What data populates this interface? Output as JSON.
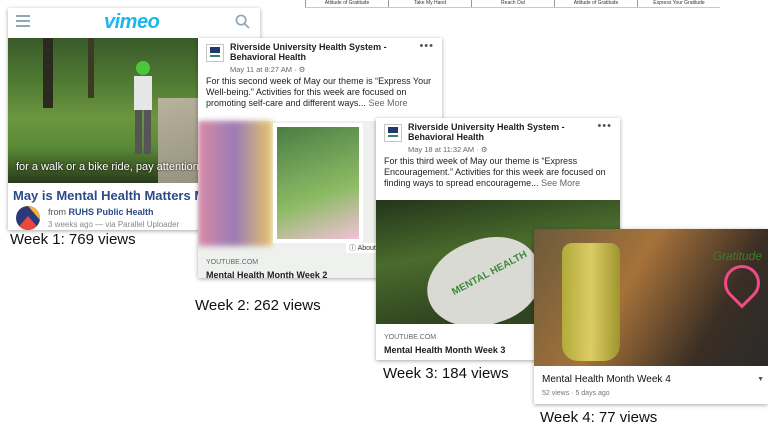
{
  "top_strip": [
    "Attitude of Gratitude",
    "Take My Hand",
    "Reach Out",
    "Attitude of Gratitude",
    "Express Your Gratitude"
  ],
  "vimeo": {
    "logo": "vimeo",
    "caption": "for a walk or a bike ride, pay attention to see how",
    "title": "May is Mental Health Matters Mo",
    "from_prefix": "from",
    "channel": "RUHS Public Health",
    "meta": "3 weeks ago — via Parallel Uploader"
  },
  "week1": "Week 1: 769 views",
  "post2": {
    "org": "Riverside University Health System - Behavioral Health",
    "date": "May 11 at 8:27 AM · ⚙",
    "more": "•••",
    "text": "For this second week of May our theme is “Express Your Well-being.” Activities for this week are focused on promoting self-care and different ways...",
    "see_more": "See More",
    "about": "About",
    "link_domain": "YOUTUBE.COM",
    "link_title": "Mental Health Month Week 2"
  },
  "week2": "Week 2: 262 views",
  "post3": {
    "org": "Riverside University Health System - Behavioral Health",
    "date": "May 18 at 11:32 AM · ⚙",
    "more": "•••",
    "text": "For this third week of May our theme is “Express Encouragement.” Activities for this week are focused on finding ways to spread encourageme...",
    "see_more": "See More",
    "rock_text": "MENTAL HEALTH",
    "link_domain": "YOUTUBE.COM",
    "link_title": "Mental Health Month Week 3"
  },
  "week3": "Week 3: 184 views",
  "youtube": {
    "overlay": "Gratitude",
    "title": "Mental Health Month Week 4",
    "meta": "52 views · 5 days ago"
  },
  "week4": "Week 4: 77 views",
  "colors": {
    "vimeo_blue": "#1ab7ea",
    "link_blue": "#2b4a86",
    "fb_gray": "#65676b"
  }
}
